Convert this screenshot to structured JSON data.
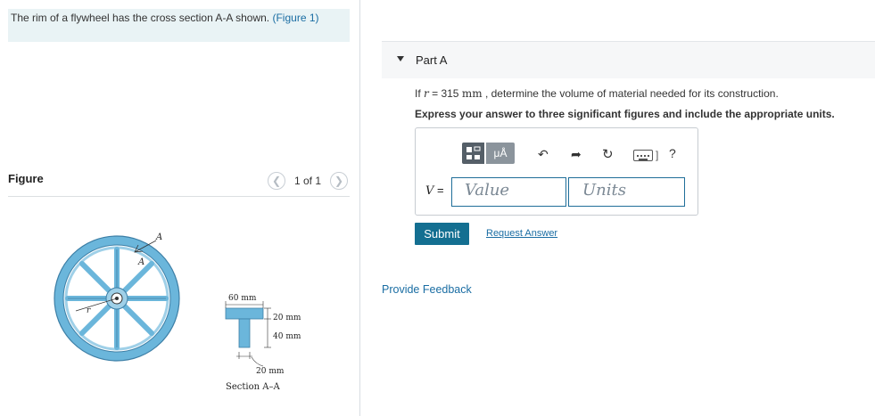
{
  "problem": {
    "text": "The rim of a flywheel has the cross section A-A shown.",
    "figure_link": "(Figure 1)"
  },
  "figure_panel": {
    "label": "Figure",
    "page_counter": "1 of 1",
    "prev_icon": "chevron-left-icon",
    "next_icon": "chevron-right-icon",
    "labels": {
      "a_top": "A",
      "a_bottom": "A",
      "r": "r",
      "dim_60": "60 mm",
      "dim_20_top": "20 mm",
      "dim_40": "40 mm",
      "dim_20_bottom": "20 mm",
      "section": "Section A–A"
    }
  },
  "part": {
    "title": "Part A",
    "question_prefix": "If",
    "question_var": "r",
    "question_eq": "= 315",
    "question_unit": "mm",
    "question_suffix": ", determine the volume of material needed for its construction.",
    "instruction": "Express your answer to three significant figures and include the appropriate units."
  },
  "answer": {
    "toolbar": {
      "greek_label": "μÅ",
      "icons": [
        "templates-icon",
        "greek-symbols-icon",
        "undo-icon",
        "redo-icon",
        "reset-icon",
        "keyboard-icon",
        "help-icon"
      ],
      "help_label": "?"
    },
    "var_name": "V",
    "equals": "=",
    "value_placeholder": "Value",
    "units_placeholder": "Units"
  },
  "actions": {
    "submit": "Submit",
    "request": "Request Answer",
    "feedback": "Provide Feedback"
  },
  "colors": {
    "accent": "#146f91",
    "link": "#1a6da3",
    "wheel": "#6bb6db"
  }
}
